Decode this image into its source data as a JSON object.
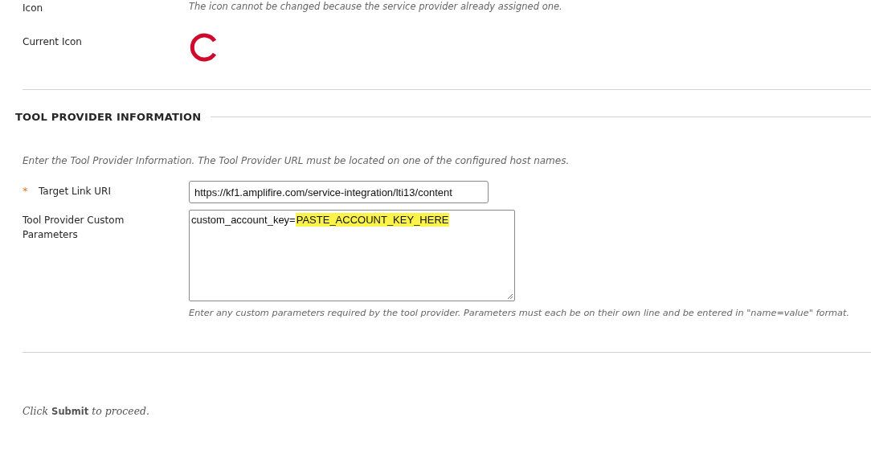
{
  "icon_row": {
    "label": "Icon",
    "hint": "The icon cannot be changed because the service provider already assigned one."
  },
  "current_icon": {
    "label": "Current Icon"
  },
  "section": {
    "title": "TOOL PROVIDER INFORMATION",
    "instructions": "Enter the Tool Provider Information. The Tool Provider URL must be located on one of the configured host names.",
    "fields": [
      {
        "kind": "input",
        "label": "Target Link URI",
        "required": true,
        "required_mark": "*",
        "value": "https://kf1.amplifire.com/service-integration/lti13/content"
      },
      {
        "kind": "textarea",
        "label": "Tool Provider Custom Parameters",
        "required": false,
        "value": "custom_account_key=",
        "highlight": "PASTE_ACCOUNT_KEY_HERE",
        "hint": "Enter any custom parameters required by the tool provider. Parameters must each be on their own line and be entered in \"name=value\" format."
      }
    ]
  },
  "footer": "Click **Submit** to proceed."
}
